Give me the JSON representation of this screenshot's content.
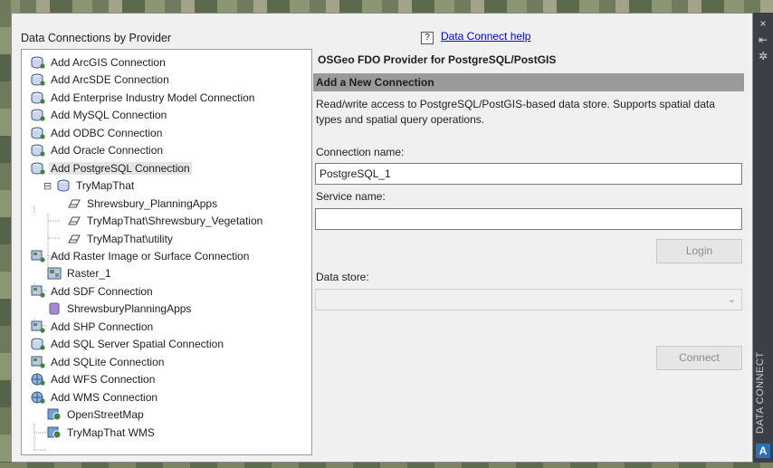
{
  "palette": {
    "panel_title": "Data Connections by Provider",
    "side_title": "DATA CONNECT",
    "side_logo": "A",
    "side_buttons": [
      "×",
      "⇤",
      "✲"
    ]
  },
  "tree": {
    "items": [
      {
        "label": "Add ArcGIS Connection",
        "icon": "add-connection-icon"
      },
      {
        "label": "Add ArcSDE Connection",
        "icon": "add-connection-icon"
      },
      {
        "label": "Add Enterprise Industry Model Connection",
        "icon": "add-connection-icon"
      },
      {
        "label": "Add MySQL Connection",
        "icon": "add-connection-icon"
      },
      {
        "label": "Add ODBC Connection",
        "icon": "add-connection-icon"
      },
      {
        "label": "Add Oracle Connection",
        "icon": "add-connection-icon"
      },
      {
        "label": "Add PostgreSQL Connection",
        "icon": "add-connection-icon"
      },
      {
        "label": "TryMapThat",
        "icon": "database-icon"
      },
      {
        "label": "Shrewsbury_PlanningApps",
        "icon": "polygon-layer-icon"
      },
      {
        "label": "TryMapThat\\Shrewsbury_Vegetation",
        "icon": "polygon-layer-icon"
      },
      {
        "label": "TryMapThat\\utility",
        "icon": "polygon-layer-icon"
      },
      {
        "label": "Add Raster Image or Surface Connection",
        "icon": "add-raster-icon"
      },
      {
        "label": "Raster_1",
        "icon": "raster-icon"
      },
      {
        "label": "Add SDF Connection",
        "icon": "add-raster-icon"
      },
      {
        "label": "ShrewsburyPlanningApps",
        "icon": "sdf-file-icon"
      },
      {
        "label": "Add SHP Connection",
        "icon": "add-raster-icon"
      },
      {
        "label": "Add SQL Server Spatial Connection",
        "icon": "add-connection-icon"
      },
      {
        "label": "Add SQLite Connection",
        "icon": "add-raster-icon"
      },
      {
        "label": "Add WFS Connection",
        "icon": "add-globe-icon"
      },
      {
        "label": "Add WMS Connection",
        "icon": "add-globe-icon"
      },
      {
        "label": "OpenStreetMap",
        "icon": "wms-layer-icon"
      },
      {
        "label": "TryMapThat WMS",
        "icon": "wms-layer-icon"
      }
    ],
    "expander": "⊟"
  },
  "form": {
    "help_icon": "?",
    "help_link": "Data Connect help",
    "provider_title": "OSGeo FDO Provider for PostgreSQL/PostGIS",
    "section_title": "Add a New Connection",
    "description": "Read/write access to PostgreSQL/PostGIS-based data store. Supports spatial data types and spatial query operations.",
    "connection_name_label": "Connection name:",
    "connection_name_value": "PostgreSQL_1",
    "service_name_label": "Service name:",
    "service_name_value": "",
    "login_label": "Login",
    "data_store_label": "Data store:",
    "data_store_value": "",
    "connect_label": "Connect"
  },
  "colors": {
    "selected_row": "#e5e5e5",
    "section_bar": "#9a9a9a",
    "link": "#0000ee"
  }
}
